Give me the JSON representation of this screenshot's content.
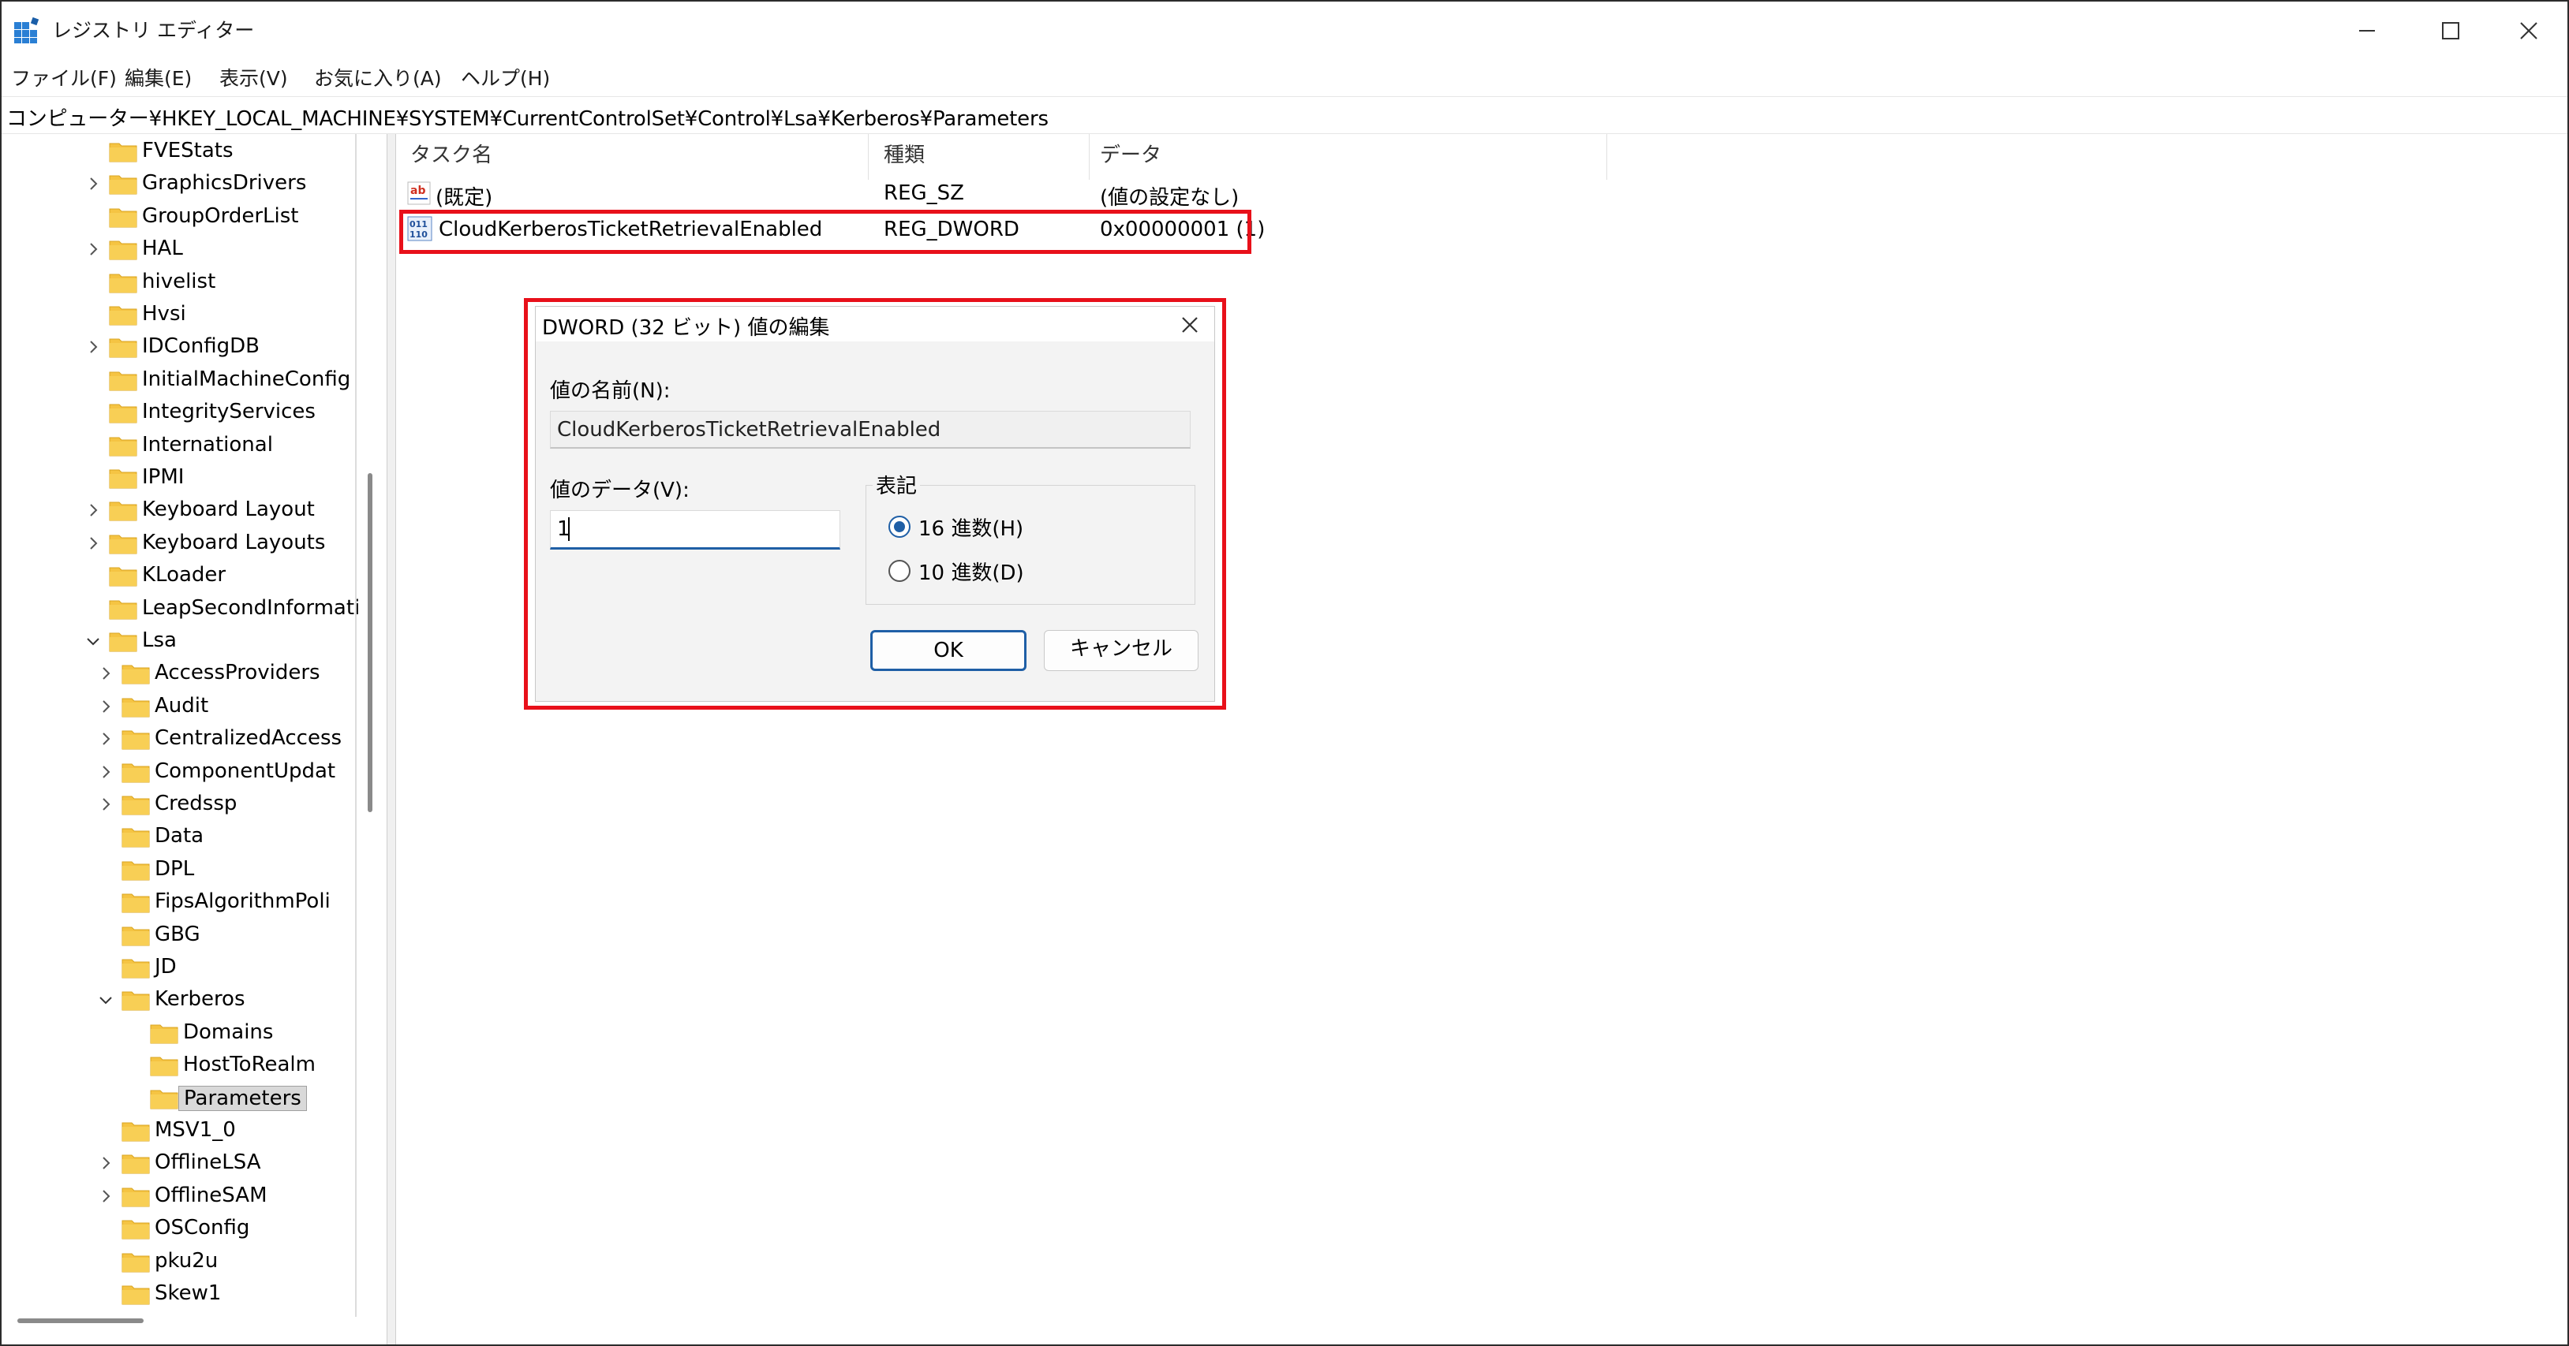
{
  "window": {
    "title": "レジストリ エディター",
    "icon": "registry-editor-icon",
    "controls": [
      "minimize-icon",
      "maximize-icon",
      "close-icon"
    ]
  },
  "menu": [
    {
      "label": "ファイル(F)"
    },
    {
      "label": "編集(E)"
    },
    {
      "label": "表示(V)"
    },
    {
      "label": "お気に入り(A)"
    },
    {
      "label": "ヘルプ(H)"
    }
  ],
  "address": "コンピューター¥HKEY_LOCAL_MACHINE¥SYSTEM¥CurrentControlSet¥Control¥Lsa¥Kerberos¥Parameters",
  "tree": [
    {
      "label": "FVEStats",
      "level": 0,
      "expander": "none"
    },
    {
      "label": "GraphicsDrivers",
      "level": 0,
      "expander": "collapsed"
    },
    {
      "label": "GroupOrderList",
      "level": 0,
      "expander": "none"
    },
    {
      "label": "HAL",
      "level": 0,
      "expander": "collapsed"
    },
    {
      "label": "hivelist",
      "level": 0,
      "expander": "none"
    },
    {
      "label": "Hvsi",
      "level": 0,
      "expander": "none"
    },
    {
      "label": "IDConfigDB",
      "level": 0,
      "expander": "collapsed"
    },
    {
      "label": "InitialMachineConfig",
      "level": 0,
      "expander": "none"
    },
    {
      "label": "IntegrityServices",
      "level": 0,
      "expander": "none"
    },
    {
      "label": "International",
      "level": 0,
      "expander": "none"
    },
    {
      "label": "IPMI",
      "level": 0,
      "expander": "none"
    },
    {
      "label": "Keyboard Layout",
      "level": 0,
      "expander": "collapsed"
    },
    {
      "label": "Keyboard Layouts",
      "level": 0,
      "expander": "collapsed"
    },
    {
      "label": "KLoader",
      "level": 0,
      "expander": "none"
    },
    {
      "label": "LeapSecondInformati",
      "level": 0,
      "expander": "none"
    },
    {
      "label": "Lsa",
      "level": 0,
      "expander": "expanded"
    },
    {
      "label": "AccessProviders",
      "level": 1,
      "expander": "collapsed"
    },
    {
      "label": "Audit",
      "level": 1,
      "expander": "collapsed"
    },
    {
      "label": "CentralizedAccess",
      "level": 1,
      "expander": "collapsed"
    },
    {
      "label": "ComponentUpdat",
      "level": 1,
      "expander": "collapsed"
    },
    {
      "label": "Credssp",
      "level": 1,
      "expander": "collapsed"
    },
    {
      "label": "Data",
      "level": 1,
      "expander": "none"
    },
    {
      "label": "DPL",
      "level": 1,
      "expander": "none"
    },
    {
      "label": "FipsAlgorithmPoli",
      "level": 1,
      "expander": "none"
    },
    {
      "label": "GBG",
      "level": 1,
      "expander": "none"
    },
    {
      "label": "JD",
      "level": 1,
      "expander": "none"
    },
    {
      "label": "Kerberos",
      "level": 1,
      "expander": "expanded"
    },
    {
      "label": "Domains",
      "level": 2,
      "expander": "none"
    },
    {
      "label": "HostToRealm",
      "level": 2,
      "expander": "none"
    },
    {
      "label": "Parameters",
      "level": 2,
      "expander": "none",
      "selected": true
    },
    {
      "label": "MSV1_0",
      "level": 1,
      "expander": "none"
    },
    {
      "label": "OfflineLSA",
      "level": 1,
      "expander": "collapsed"
    },
    {
      "label": "OfflineSAM",
      "level": 1,
      "expander": "collapsed"
    },
    {
      "label": "OSConfig",
      "level": 1,
      "expander": "none"
    },
    {
      "label": "pku2u",
      "level": 1,
      "expander": "none"
    },
    {
      "label": "Skew1",
      "level": 1,
      "expander": "none"
    }
  ],
  "list": {
    "columns": [
      "タスク名",
      "種類",
      "データ"
    ],
    "rows": [
      {
        "icon": "string-value-icon",
        "name": "(既定)",
        "type": "REG_SZ",
        "data": "(値の設定なし)"
      },
      {
        "icon": "binary-value-icon",
        "name": "CloudKerberosTicketRetrievalEnabled",
        "type": "REG_DWORD",
        "data": "0x00000001 (1)"
      }
    ]
  },
  "dialog": {
    "title": "DWORD (32 ビット) 値の編集",
    "name_label": "値の名前(N):",
    "name_value": "CloudKerberosTicketRetrievalEnabled",
    "data_label": "値のデータ(V):",
    "data_value": "1",
    "radix_label": "表記",
    "radix_hex": "16 進数(H)",
    "radix_dec": "10 進数(D)",
    "radix_selected": "hex",
    "ok": "OK",
    "cancel": "キャンセル"
  },
  "colors": {
    "highlight": "#e8101a",
    "accent": "#1f5fa6",
    "folder": "#f5c443"
  }
}
